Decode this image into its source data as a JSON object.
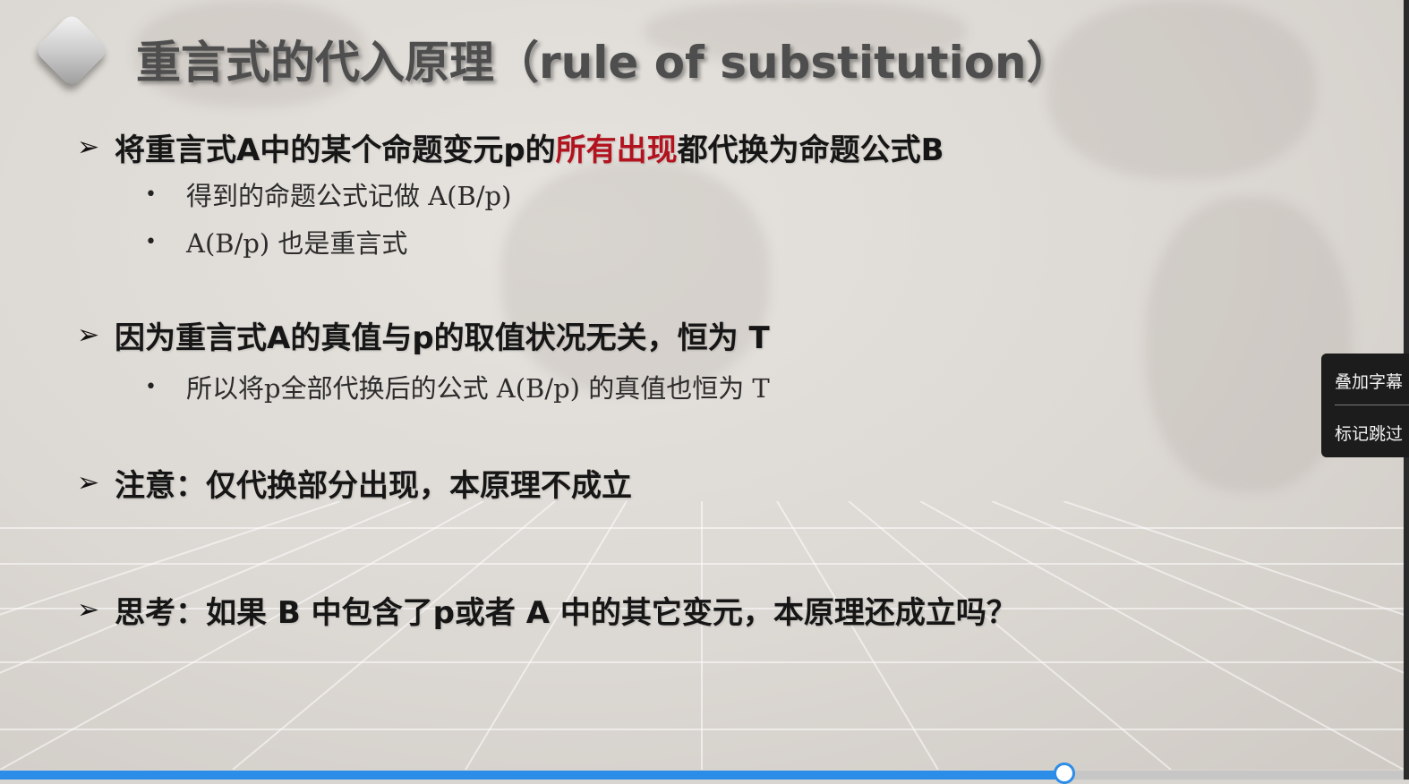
{
  "slide": {
    "title": "重言式的代入原理（rule of substitution）",
    "bullets": [
      {
        "pre": "将重言式A中的某个命题变元p的",
        "highlight": "所有出现",
        "post": "都代换为命题公式B"
      },
      {
        "text": "因为重言式A的真值与p的取值状况无关，恒为 T"
      },
      {
        "text": "注意：仅代换部分出现，本原理不成立"
      },
      {
        "text": "思考：如果 B 中包含了p或者 A 中的其它变元，本原理还成立吗？"
      }
    ],
    "sub_bullets": [
      {
        "text": "得到的命题公式记做 A(B/p)"
      },
      {
        "text": "A(B/p) 也是重言式"
      },
      {
        "text": "所以将p全部代换后的公式 A(B/p) 的真值也恒为 T"
      }
    ],
    "bullet_marker": "➢",
    "sub_marker": "•",
    "highlight_color": "#b2131e"
  },
  "side_menu": {
    "items": [
      {
        "label": "叠加字幕"
      },
      {
        "label": "标记跳过"
      }
    ]
  },
  "progress": {
    "fraction": 0.758,
    "color": "#2b8de8"
  }
}
